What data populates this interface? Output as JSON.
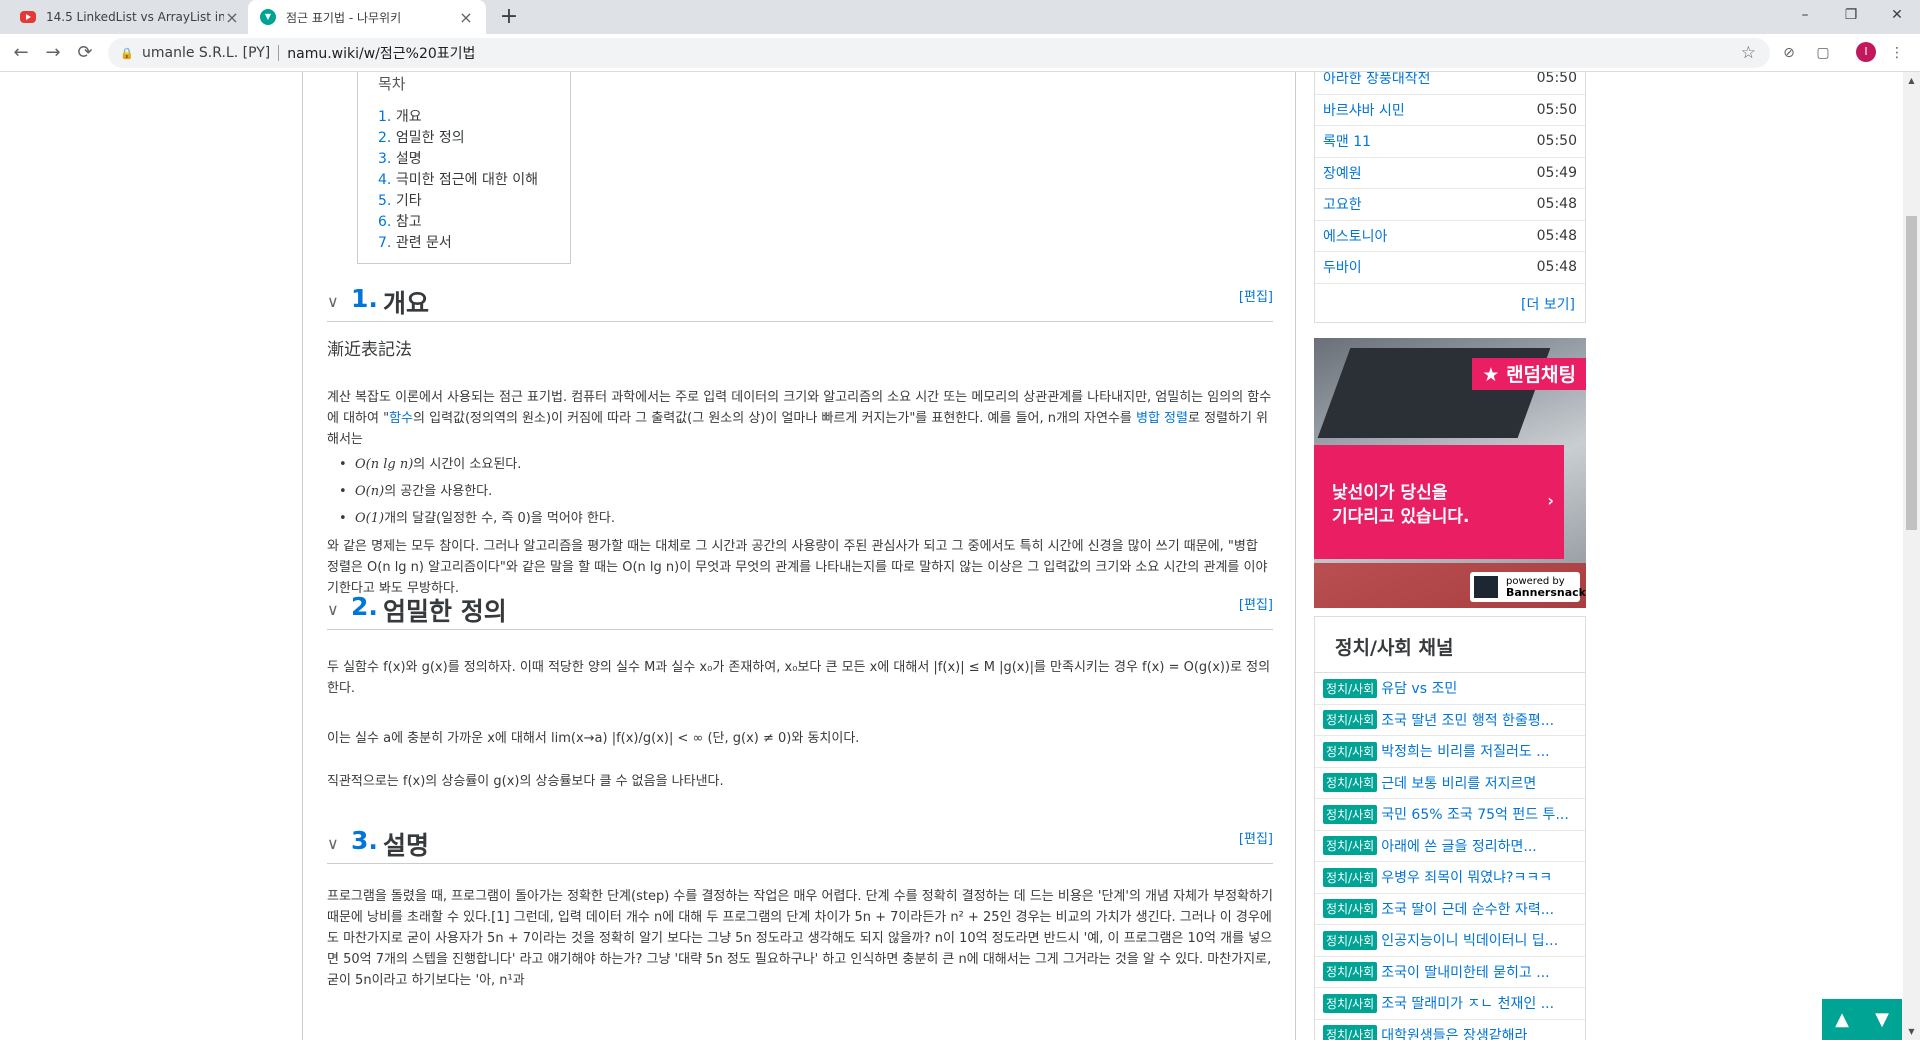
{
  "browser": {
    "tabs": [
      {
        "title": "14.5 LinkedList vs ArrayList in Ja",
        "icon": "youtube-icon"
      },
      {
        "title": "점근 표기법 - 나무위키",
        "icon": "namuwiki-icon"
      }
    ],
    "new_tab": "+",
    "window": {
      "minimize": "–",
      "maximize": "❐",
      "close": "✕"
    },
    "back": "←",
    "forward": "→",
    "reload": "⟳",
    "cert": "umanle S.R.L. [PY]",
    "url": "namu.wiki/w/점근%20표기법",
    "profile_initial": "I"
  },
  "toc": {
    "title": "목차",
    "items": [
      {
        "num": "1.",
        "label": "개요"
      },
      {
        "num": "2.",
        "label": "엄밀한 정의"
      },
      {
        "num": "3.",
        "label": "설명"
      },
      {
        "num": "4.",
        "label": "극미한 점근에 대한 이해"
      },
      {
        "num": "5.",
        "label": "기타"
      },
      {
        "num": "6.",
        "label": "참고"
      },
      {
        "num": "7.",
        "label": "관련 문서"
      }
    ]
  },
  "sections": {
    "s1": {
      "num": "1.",
      "title": "개요",
      "edit": "[편집]"
    },
    "s2": {
      "num": "2.",
      "title": "엄밀한 정의",
      "edit": "[편집]"
    },
    "s3": {
      "num": "3.",
      "title": "설명",
      "edit": "[편집]"
    }
  },
  "overview": {
    "hanja": "漸近表記法",
    "p1a": "계산 복잡도 이론에서 사용되는 점근 표기법. 컴퓨터 과학에서는 주로 입력 데이터의 크기와 알고리즘의 소요 시간 또는 메모리의 상관관계를 나타내지만, 엄밀히는 임의의 함수에 대하여 \"",
    "link_func": "함수",
    "p1b": "의 입력값(정의역의 원소)이 커짐에 따라 그 출력값(그 원소의 상)이 얼마나 빠르게 커지는가\"를 표현한다. 예를 들어, n개의 자연수를 ",
    "link_merge": "병합 정렬",
    "p1c": "로 정렬하기 위해서는",
    "bullets": [
      {
        "math": "O(n lg n)",
        "text": "의 시간이 소요된다."
      },
      {
        "math": "O(n)",
        "text": "의 공간을 사용한다."
      },
      {
        "math": "O(1)",
        "text": "개의 달걀(일정한 수, 즉 0)을 먹어야 한다."
      }
    ],
    "p2": "와 같은 명제는 모두 참이다. 그러나 알고리즘을 평가할 때는 대체로 그 시간과 공간의 사용량이 주된 관심사가 되고 그 중에서도 특히 시간에 신경을 많이 쓰기 때문에, \"병합 정렬은 O(n lg n) 알고리즘이다\"와 같은 말을 할 때는 O(n lg n)이 무엇과 무엇의 관계를 나타내는지를 따로 말하지 않는 이상은 그 입력값의 크기와 소요 시간의 관계를 이야기한다고 봐도 무방하다."
  },
  "definition": {
    "p1": "두 실함수 f(x)와 g(x)를 정의하자. 이때 적당한 양의 실수 M과 실수 x₀가 존재하여, x₀보다 큰 모든 x에 대해서 |f(x)| ≤ M |g(x)|를 만족시키는 경우 f(x) = O(g(x))로 정의한다.",
    "p2": "이는 실수 a에 충분히 가까운 x에 대해서 lim(x→a) |f(x)/g(x)| < ∞ (단, g(x) ≠ 0)와 동치이다.",
    "p3": "직관적으로는 f(x)의 상승률이 g(x)의 상승률보다 클 수 없음을 나타낸다."
  },
  "explain": {
    "p1": "프로그램을 돌렸을 때, 프로그램이 돌아가는 정확한 단계(step) 수를 결정하는 작업은 매우 어렵다. 단계 수를 정확히 결정하는 데 드는 비용은 '단계'의 개념 자체가 부정확하기 때문에 낭비를 초래할 수 있다.[1] 그런데, 입력 데이터 개수 n에 대해 두 프로그램의 단계 차이가 5n + 7이라든가 n² + 25인 경우는 비교의 가치가 생긴다. 그러나 이 경우에도 마찬가지로 굳이 사용자가 5n + 7이라는 것을 정확히 알기 보다는 그냥 5n 정도라고 생각해도 되지 않을까? n이 10억 정도라면 반드시 '예, 이 프로그램은 10억 개를 넣으면 50억 7개의 스텝을 진행합니다' 라고 얘기해야 하는가? 그냥 '대략 5n 정도 필요하구나' 하고 인식하면 충분히 큰 n에 대해서는 그게 그거라는 것을 알 수 있다. 마찬가지로, 굳이 5n이라고 하기보다는 '아, n¹과"
  },
  "recent": {
    "items": [
      {
        "name": "아라한 장풍대작전",
        "time": "05:50"
      },
      {
        "name": "바르샤바 시민",
        "time": "05:50"
      },
      {
        "name": "록맨 11",
        "time": "05:50"
      },
      {
        "name": "장예원",
        "time": "05:49"
      },
      {
        "name": "고요한",
        "time": "05:48"
      },
      {
        "name": "에스토니아",
        "time": "05:48"
      },
      {
        "name": "두바이",
        "time": "05:48"
      }
    ],
    "more": "[더 보기]"
  },
  "ad": {
    "badge": "★ 랜덤채팅",
    "line1": "낯선이가 당신을",
    "line2": "기다리고 있습니다.",
    "arrow": "›",
    "powered": "powered by",
    "brand": "Bannersnack"
  },
  "channel": {
    "title": "정치/사회 채널",
    "tag": "정치/사회",
    "items": [
      "유담 vs 조민",
      "조국 딸년 조민 행적 한줄평...",
      "박정희는 비리를 저질러도 ...",
      "근데 보통 비리를 저지르면",
      "국민 65% 조국 75억 펀드 투...",
      "아래에 쓴 글을 정리하면...",
      "우병우 죄목이 뭐였냐?ㅋㅋㅋ",
      "조국 딸이 근데 순수한 자력...",
      "인공지능이니 빅데이터니 딥...",
      "조국이 딸내미한테 묻히고 ...",
      "조국 딸래미가 ㅈㄴ 천재인 ...",
      "대학원생들은 장생같해라"
    ]
  },
  "fab": {
    "up": "▲",
    "down": "▼"
  },
  "colors": {
    "link": "#0275d8",
    "accent": "#00a495",
    "ad_pink": "#e91e63"
  }
}
